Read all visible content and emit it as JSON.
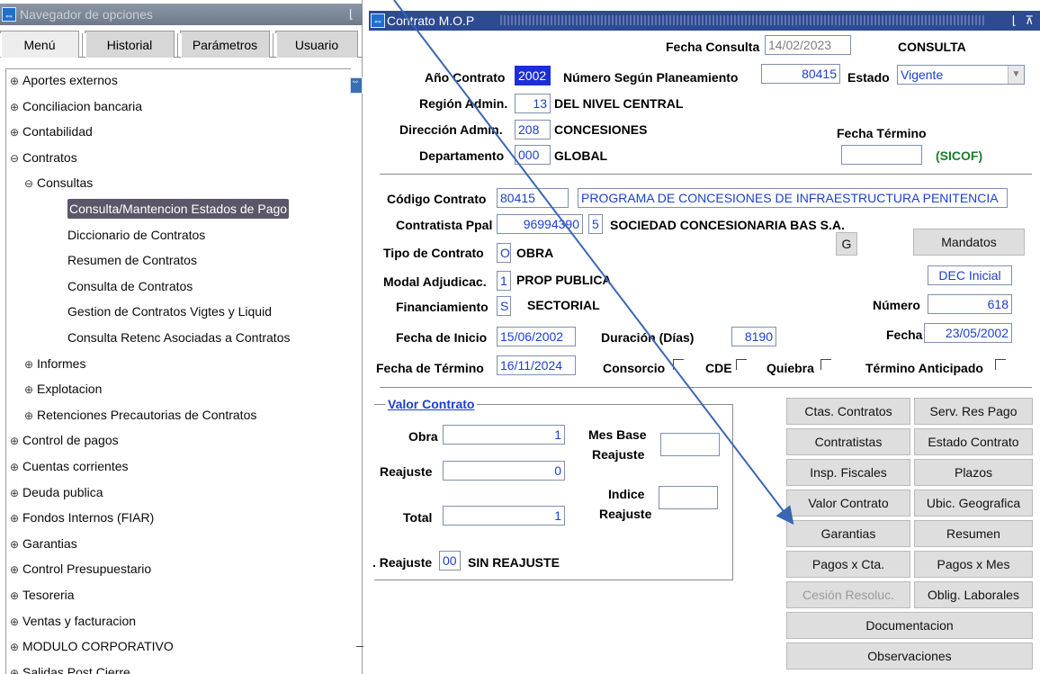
{
  "navigator": {
    "title": "Navegador de opciones",
    "tabs": [
      "Menú",
      "Historial",
      "Parámetros",
      "Usuario"
    ],
    "tree": [
      {
        "label": "Aportes externos",
        "exp": "⊕",
        "level": 0
      },
      {
        "label": "Conciliacion bancaria",
        "exp": "⊕",
        "level": 0
      },
      {
        "label": "Contabilidad",
        "exp": "⊕",
        "level": 0
      },
      {
        "label": "Contratos",
        "exp": "⊖",
        "level": 0
      },
      {
        "label": "Consultas",
        "exp": "⊖",
        "level": 1
      },
      {
        "label": "Consulta/Mantencion Estados de Pago",
        "exp": "",
        "level": 2,
        "selected": true
      },
      {
        "label": "Diccionario de Contratos",
        "exp": "",
        "level": 2
      },
      {
        "label": "Resumen de Contratos",
        "exp": "",
        "level": 2
      },
      {
        "label": "Consulta de Contratos",
        "exp": "",
        "level": 2
      },
      {
        "label": "Gestion de Contratos Vigtes y Liquid",
        "exp": "",
        "level": 2
      },
      {
        "label": "Consulta Retenc Asociadas a Contratos",
        "exp": "",
        "level": 2
      },
      {
        "label": "Informes",
        "exp": "⊕",
        "level": 1
      },
      {
        "label": "Explotacion",
        "exp": "⊕",
        "level": 1
      },
      {
        "label": "Retenciones Precautorias de Contratos",
        "exp": "⊕",
        "level": 1
      },
      {
        "label": "Control de pagos",
        "exp": "⊕",
        "level": 0
      },
      {
        "label": "Cuentas corrientes",
        "exp": "⊕",
        "level": 0
      },
      {
        "label": "Deuda publica",
        "exp": "⊕",
        "level": 0
      },
      {
        "label": "Fondos Internos (FIAR)",
        "exp": "⊕",
        "level": 0
      },
      {
        "label": "Garantias",
        "exp": "⊕",
        "level": 0
      },
      {
        "label": "Control Presupuestario",
        "exp": "⊕",
        "level": 0
      },
      {
        "label": "Tesoreria",
        "exp": "⊕",
        "level": 0
      },
      {
        "label": "Ventas y facturacion",
        "exp": "⊕",
        "level": 0
      },
      {
        "label": "MODULO CORPORATIVO",
        "exp": "⊕",
        "level": 0
      },
      {
        "label": "Salidas Post Cierre",
        "exp": "⊕",
        "level": 0
      }
    ]
  },
  "form": {
    "title": "Contrato M.O.P",
    "fecha_consulta_label": "Fecha Consulta",
    "fecha_consulta": "14/02/2023",
    "modo": "CONSULTA",
    "anio_label": "Año Contrato",
    "anio": "2002",
    "numero_planeamiento_label": "Número Según Planeamiento",
    "numero_planeamiento": "80415",
    "estado_label": "Estado",
    "estado": "Vigente",
    "region_label": "Región Admin.",
    "region_code": "13",
    "region_name": "DEL NIVEL CENTRAL",
    "direccion_label": "Dirección Admin.",
    "direccion_code": "208",
    "direccion_name": "CONCESIONES",
    "fecha_termino_label": "Fecha Término",
    "fecha_termino_sicof": "",
    "sicof": "(SICOF)",
    "departamento_label": "Departamento",
    "departamento_code": "000",
    "departamento_name": "GLOBAL",
    "codigo_label": "Código Contrato",
    "codigo": "80415",
    "codigo_desc": "PROGRAMA DE CONCESIONES DE INFRAESTRUCTURA PENITENCIA",
    "contratista_label": "Contratista Ppal",
    "contratista_rut": "96994390",
    "contratista_dv": "5",
    "contratista_name": "SOCIEDAD CONCESIONARIA BAS S.A.",
    "g_button": "G",
    "mandatos_button": "Mandatos",
    "tipo_label": "Tipo de Contrato",
    "tipo_code": "O",
    "tipo_name": "OBRA",
    "modal_label": "Modal Adjudicac.",
    "modal_code": "1",
    "modal_name": "PROP PUBLICA",
    "dec_inicial": "DEC Inicial",
    "financiamiento_label": "Financiamiento",
    "financiamiento_code": "S",
    "financiamiento_name": "SECTORIAL",
    "numero_label": "Número",
    "numero": "618",
    "fecha_inicio_label": "Fecha de Inicio",
    "fecha_inicio": "15/06/2002",
    "duracion_label": "Duración (Días)",
    "duracion": "8190",
    "fecha_label": "Fecha",
    "fecha": "23/05/2002",
    "fecha_termino2_label": "Fecha de Término",
    "fecha_termino2": "16/11/2024",
    "consorcio_label": "Consorcio",
    "cde_label": "CDE",
    "quiebra_label": "Quiebra",
    "termino_anticipado_label": "Término Anticipado",
    "valor_contrato_title": "Valor Contrato",
    "obra_label": "Obra",
    "obra_value": "1",
    "mes_base_label_1": "Mes Base",
    "mes_base_label_2": "Reajuste",
    "mes_base_value": "",
    "reajuste_label": "Reajuste",
    "reajuste_value": "0",
    "indice_label_1": "Indice",
    "indice_label_2": "Reajuste",
    "indice_value": "",
    "total_label": "Total",
    "total_value": "1",
    "tipo_reajuste_label": ". Reajuste",
    "tipo_reajuste_code": "00",
    "tipo_reajuste_name": "SIN REAJUSTE"
  },
  "buttons": {
    "ctas_contratos": "Ctas. Contratos",
    "serv_res_pago": "Serv. Res Pago",
    "contratistas": "Contratistas",
    "estado_contrato": "Estado Contrato",
    "insp_fiscales": "Insp. Fiscales",
    "plazos": "Plazos",
    "valor_contrato": "Valor Contrato",
    "ubic_geografica": "Ubic. Geografica",
    "garantias": "Garantias",
    "resumen": "Resumen",
    "pagos_x_cta": "Pagos x Cta.",
    "pagos_x_mes": "Pagos x Mes",
    "cesion_resoluc": "Cesión Resoluc.",
    "oblig_laborales": "Oblig. Laborales",
    "documentacion": "Documentacion",
    "observaciones": "Observaciones"
  },
  "colors": {
    "field_text": "#1b3fd1",
    "title_bar": "#2d4a92",
    "selection": "#5b5668",
    "annotation_arrow": "#3b66b5"
  }
}
